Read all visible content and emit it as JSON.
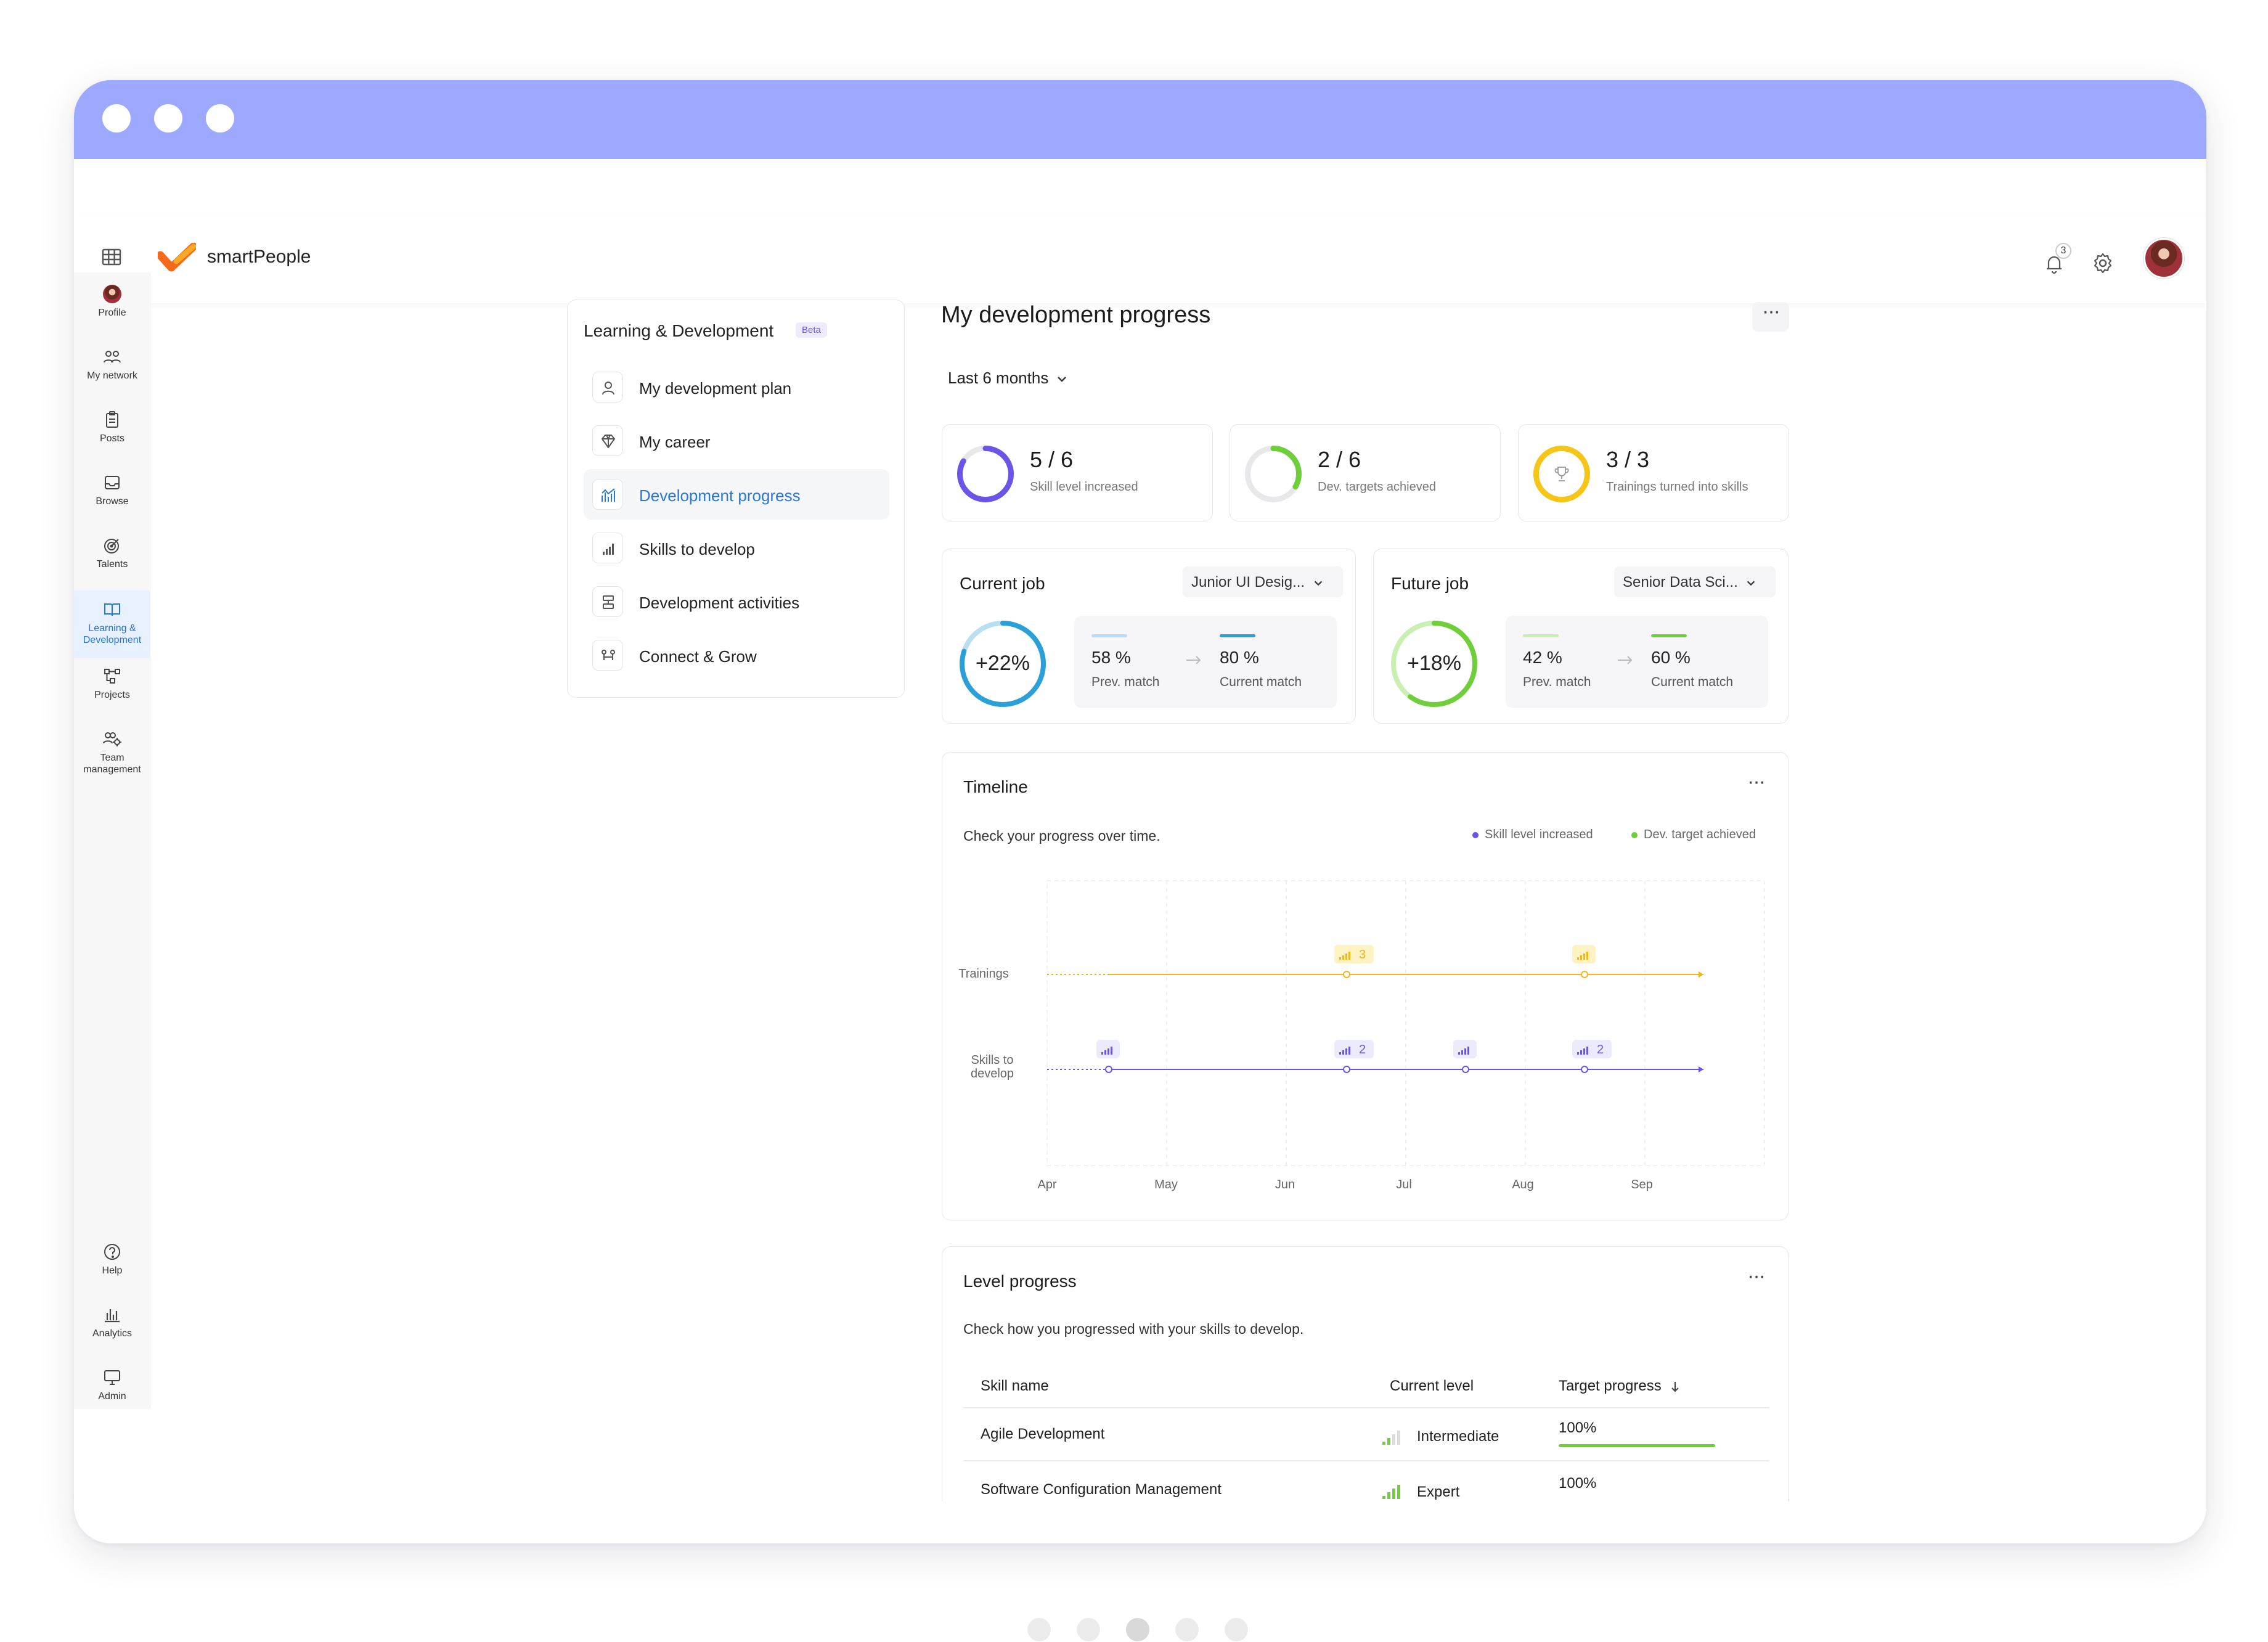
{
  "app": {
    "brand": "smartPeople",
    "notifications_count": "3"
  },
  "sidebar": {
    "items": [
      {
        "label": "Profile",
        "icon": "avatar"
      },
      {
        "label": "My network",
        "icon": "people-icon"
      },
      {
        "label": "Posts",
        "icon": "clipboard-icon"
      },
      {
        "label": "Browse",
        "icon": "inbox-icon"
      },
      {
        "label": "Talents",
        "icon": "target-icon"
      },
      {
        "label": "Learning & Development",
        "icon": "book-icon",
        "active": true
      },
      {
        "label": "Projects",
        "icon": "flow-icon"
      },
      {
        "label": "Team management",
        "icon": "team-gear-icon"
      }
    ],
    "bottom": [
      {
        "label": "Help",
        "icon": "help-icon"
      },
      {
        "label": "Analytics",
        "icon": "bar-chart-icon"
      },
      {
        "label": "Admin",
        "icon": "monitor-icon"
      }
    ]
  },
  "ld_panel": {
    "title": "Learning & Development",
    "badge": "Beta",
    "items": [
      {
        "label": "My development plan",
        "icon": "person-icon"
      },
      {
        "label": "My career",
        "icon": "diamond-icon"
      },
      {
        "label": "Development progress",
        "icon": "progress-chart-icon",
        "active": true
      },
      {
        "label": "Skills to develop",
        "icon": "skill-bars-icon"
      },
      {
        "label": "Development activities",
        "icon": "activities-icon"
      },
      {
        "label": "Connect & Grow",
        "icon": "connect-icon"
      }
    ]
  },
  "main": {
    "title": "My development progress",
    "filter": "Last 6 months",
    "stats": [
      {
        "value": "5 / 6",
        "label": "Skill level increased",
        "progress": 0.833,
        "color": "#6c54e6"
      },
      {
        "value": "2 / 6",
        "label": "Dev. targets achieved",
        "progress": 0.333,
        "color": "#6fcf3a"
      },
      {
        "value": "3 / 3",
        "label": "Trainings turned into skills",
        "progress": 1.0,
        "color": "#f5c518"
      }
    ],
    "current_job": {
      "title": "Current job",
      "select": "Junior UI Desig...",
      "delta": "+22%",
      "prev_value": "58 %",
      "prev_label": "Prev. match",
      "cur_value": "80 %",
      "cur_label": "Current match",
      "ring_progress": 0.8,
      "color": "#2ba0d8",
      "light_color": "#b9dff2"
    },
    "future_job": {
      "title": "Future job",
      "select": "Senior Data Sci...",
      "delta": "+18%",
      "prev_value": "42 %",
      "prev_label": "Prev. match",
      "cur_value": "60 %",
      "cur_label": "Current match",
      "ring_progress": 0.6,
      "color": "#6fcf3a",
      "light_color": "#cbeeb3"
    },
    "timeline": {
      "title": "Timeline",
      "subtitle": "Check your progress over time.",
      "legend": [
        {
          "label": "Skill level increased",
          "color": "#6c54e6"
        },
        {
          "label": "Dev. target achieved",
          "color": "#6fcf3a"
        }
      ],
      "rows": [
        "Trainings",
        "Skills to develop"
      ],
      "months": [
        "Apr",
        "May",
        "Jun",
        "Jul",
        "Aug",
        "Sep"
      ],
      "trainings_events": [
        {
          "month_index": 2,
          "count": "3"
        },
        {
          "month_index": 4,
          "count": ""
        }
      ],
      "skills_events": [
        {
          "month_index": 0,
          "count": ""
        },
        {
          "month_index": 2,
          "count": "2"
        },
        {
          "month_index": 3,
          "count": ""
        },
        {
          "month_index": 4,
          "count": "2"
        }
      ]
    },
    "level_progress": {
      "title": "Level progress",
      "subtitle": "Check how you progressed with your skills to develop.",
      "headers": {
        "skill": "Skill name",
        "level": "Current level",
        "target": "Target progress"
      },
      "rows": [
        {
          "skill": "Agile Development",
          "level": "Intermediate",
          "target": "100%",
          "target_fraction": 1.0,
          "level_steps": 2
        },
        {
          "skill": "Software Configuration Management",
          "level": "Expert",
          "target": "100%",
          "target_fraction": 1.0,
          "level_steps": 4
        }
      ]
    }
  },
  "pager": {
    "count": 5,
    "active_index": 2
  }
}
